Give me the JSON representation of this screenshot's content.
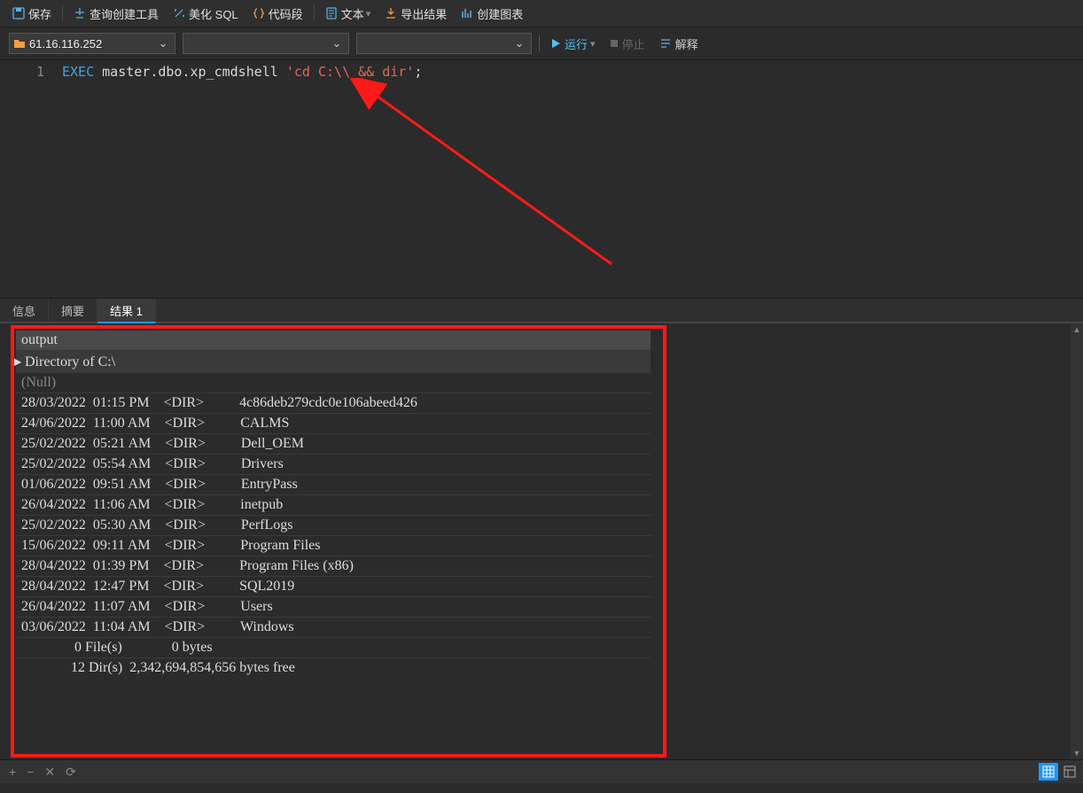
{
  "toolbar": {
    "save": "保存",
    "query_builder": "查询创建工具",
    "beautify": "美化 SQL",
    "snippets": "代码段",
    "text": "文本",
    "export": "导出结果",
    "chart": "创建图表"
  },
  "toolbar2": {
    "connection": "61.16.116.252",
    "run": "运行",
    "stop": "停止",
    "explain": "解释"
  },
  "editor": {
    "line_number": "1",
    "kw": "EXEC",
    "ident": " master.dbo.xp_cmdshell ",
    "str": "'cd C:\\\\ && dir'",
    "punc": ";"
  },
  "tabs": {
    "info": "信息",
    "summary": "摘要",
    "result": "结果 1"
  },
  "grid": {
    "header": "output",
    "rows": [
      {
        "text": " Directory of C:\\",
        "selected": true,
        "marker": "▶"
      },
      {
        "text": "(Null)",
        "null": true
      },
      {
        "text": "28/03/2022  01:15 PM    <DIR>          4c86deb279cdc0e106abeed426"
      },
      {
        "text": "24/06/2022  11:00 AM    <DIR>          CALMS"
      },
      {
        "text": "25/02/2022  05:21 AM    <DIR>          Dell_OEM"
      },
      {
        "text": "25/02/2022  05:54 AM    <DIR>          Drivers"
      },
      {
        "text": "01/06/2022  09:51 AM    <DIR>          EntryPass"
      },
      {
        "text": "26/04/2022  11:06 AM    <DIR>          inetpub"
      },
      {
        "text": "25/02/2022  05:30 AM    <DIR>          PerfLogs"
      },
      {
        "text": "15/06/2022  09:11 AM    <DIR>          Program Files"
      },
      {
        "text": "28/04/2022  01:39 PM    <DIR>          Program Files (x86)"
      },
      {
        "text": "28/04/2022  12:47 PM    <DIR>          SQL2019"
      },
      {
        "text": "26/04/2022  11:07 AM    <DIR>          Users"
      },
      {
        "text": "03/06/2022  11:04 AM    <DIR>          Windows"
      },
      {
        "text": "               0 File(s)              0 bytes"
      },
      {
        "text": "              12 Dir(s)  2,342,694,854,656 bytes free"
      }
    ]
  },
  "statusbar": {
    "add": "+",
    "remove": "−",
    "cancel": "✕",
    "refresh": "⟳"
  }
}
